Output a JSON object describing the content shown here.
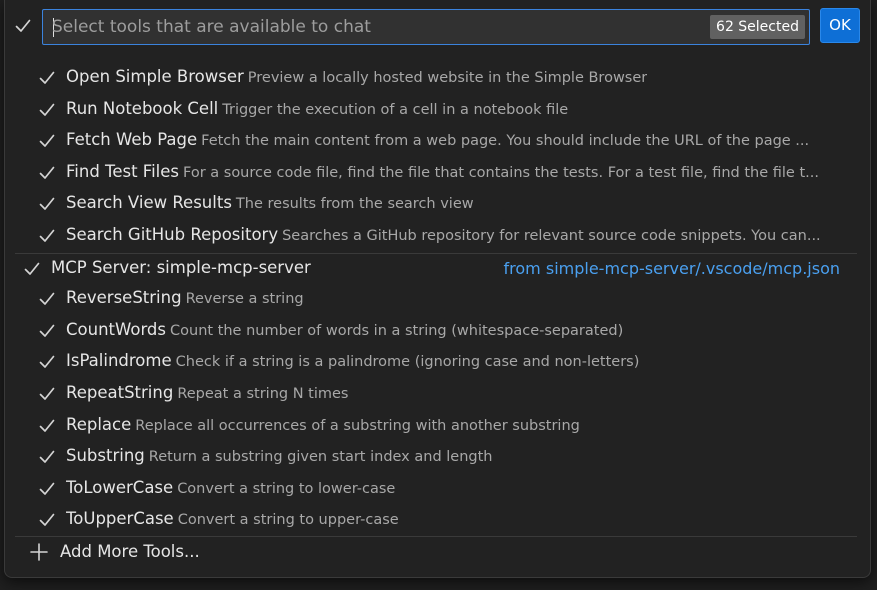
{
  "header": {
    "search_placeholder": "Select tools that are available to chat",
    "selected_count": "62 Selected",
    "ok_label": "OK"
  },
  "tools_builtin": [
    {
      "name": "Open Simple Browser",
      "description": "Preview a locally hosted website in the Simple Browser",
      "checked": true
    },
    {
      "name": "Run Notebook Cell",
      "description": "Trigger the execution of a cell in a notebook file",
      "checked": true
    },
    {
      "name": "Fetch Web Page",
      "description": "Fetch the main content from a web page. You should include the URL of the page ...",
      "checked": true
    },
    {
      "name": "Find Test Files",
      "description": "For a source code file, find the file that contains the tests. For a test file, find the file t...",
      "checked": true
    },
    {
      "name": "Search View Results",
      "description": "The results from the search view",
      "checked": true
    },
    {
      "name": "Search GitHub Repository",
      "description": "Searches a GitHub repository for relevant source code snippets. You can...",
      "checked": true
    }
  ],
  "mcp_group": {
    "label": "MCP Server: simple-mcp-server",
    "source": "from simple-mcp-server/.vscode/mcp.json",
    "checked": true
  },
  "tools_mcp": [
    {
      "name": "ReverseString",
      "description": "Reverse a string",
      "checked": true
    },
    {
      "name": "CountWords",
      "description": "Count the number of words in a string (whitespace-separated)",
      "checked": true
    },
    {
      "name": "IsPalindrome",
      "description": "Check if a string is a palindrome (ignoring case and non-letters)",
      "checked": true
    },
    {
      "name": "RepeatString",
      "description": "Repeat a string N times",
      "checked": true
    },
    {
      "name": "Replace",
      "description": "Replace all occurrences of a substring with another substring",
      "checked": true
    },
    {
      "name": "Substring",
      "description": "Return a substring given start index and length",
      "checked": true
    },
    {
      "name": "ToLowerCase",
      "description": "Convert a string to lower-case",
      "checked": true
    },
    {
      "name": "ToUpperCase",
      "description": "Convert a string to upper-case",
      "checked": true
    }
  ],
  "footer": {
    "add_more_label": "Add More Tools..."
  },
  "icons": {
    "checkbox": "check-icon",
    "add": "plus-icon"
  },
  "colors": {
    "accent": "#0e6fd6",
    "focus_border": "#3b83dd",
    "link": "#4aa0f0",
    "badge_bg": "#616161"
  }
}
